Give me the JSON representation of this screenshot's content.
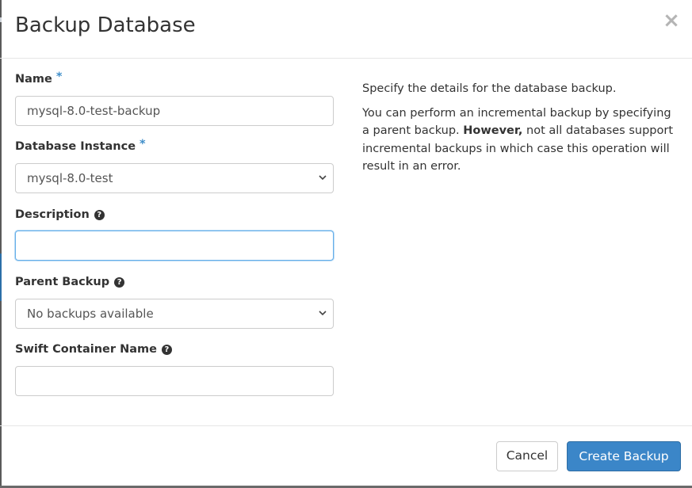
{
  "modal": {
    "title": "Backup Database",
    "close_icon": "×"
  },
  "form": {
    "name": {
      "label": "Name",
      "required_mark": "*",
      "value": "mysql-8.0-test-backup"
    },
    "database_instance": {
      "label": "Database Instance",
      "required_mark": "*",
      "selected": "mysql-8.0-test"
    },
    "description": {
      "label": "Description",
      "help_icon": "?",
      "value": ""
    },
    "parent_backup": {
      "label": "Parent Backup",
      "help_icon": "?",
      "selected": "No backups available"
    },
    "swift_container_name": {
      "label": "Swift Container Name",
      "help_icon": "?",
      "value": ""
    }
  },
  "help": {
    "para1": "Specify the details for the database backup.",
    "para2_start": "You can perform an incremental backup by specifying a parent backup. ",
    "para2_bold": "However,",
    "para2_end": " not all databases support incremental backups in which case this operation will result in an error."
  },
  "footer": {
    "cancel_label": "Cancel",
    "create_label": "Create Backup"
  },
  "colors": {
    "accent": "#3b86c8",
    "required": "#3f8ec9",
    "focus_border": "#66afe9"
  }
}
